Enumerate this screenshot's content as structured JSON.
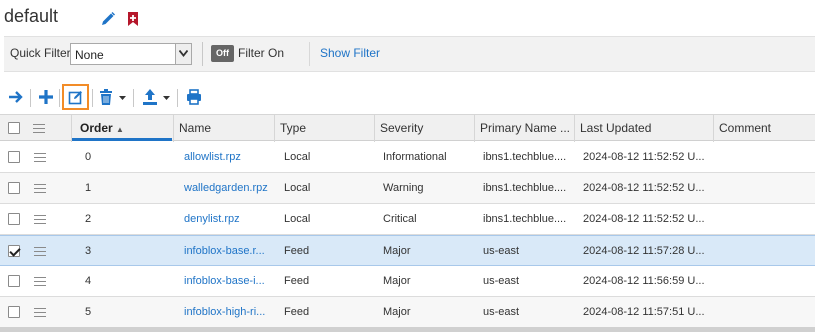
{
  "header": {
    "title": "default"
  },
  "filter_bar": {
    "quick_filter_label": "Quick Filter",
    "quick_filter_value": "None",
    "toggle_label": "Off",
    "filter_on_label": "Filter On",
    "show_filter_label": "Show Filter"
  },
  "toolbar": {
    "icons": [
      "arrow-right-icon",
      "plus-icon",
      "edit-icon",
      "trash-icon",
      "upload-icon",
      "print-icon"
    ]
  },
  "table": {
    "columns": [
      "Order",
      "Name",
      "Type",
      "Severity",
      "Primary Name ...",
      "Last Updated",
      "Comment"
    ],
    "sort_indicator": "▲",
    "rows": [
      {
        "order": "0",
        "name": "allowlist.rpz",
        "type": "Local",
        "severity": "Informational",
        "primary": "ibns1.techblue....",
        "updated": "2024-08-12 11:52:52 U...",
        "comment": "",
        "checked": false
      },
      {
        "order": "1",
        "name": "walledgarden.rpz",
        "type": "Local",
        "severity": "Warning",
        "primary": "ibns1.techblue....",
        "updated": "2024-08-12 11:52:52 U...",
        "comment": "",
        "checked": false
      },
      {
        "order": "2",
        "name": "denylist.rpz",
        "type": "Local",
        "severity": "Critical",
        "primary": "ibns1.techblue....",
        "updated": "2024-08-12 11:52:52 U...",
        "comment": "",
        "checked": false
      },
      {
        "order": "3",
        "name": "infoblox-base.r...",
        "type": "Feed",
        "severity": "Major",
        "primary": "us-east",
        "updated": "2024-08-12 11:57:28 U...",
        "comment": "",
        "checked": true
      },
      {
        "order": "4",
        "name": "infoblox-base-i...",
        "type": "Feed",
        "severity": "Major",
        "primary": "us-east",
        "updated": "2024-08-12 11:56:59 U...",
        "comment": "",
        "checked": false
      },
      {
        "order": "5",
        "name": "infoblox-high-ri...",
        "type": "Feed",
        "severity": "Major",
        "primary": "us-east",
        "updated": "2024-08-12 11:57:51 U...",
        "comment": "",
        "checked": false
      }
    ]
  },
  "colors": {
    "accent": "#1f74c7",
    "highlight": "#f28c28",
    "selected_row": "#d9e9f8",
    "bookmark": "#b5172b"
  }
}
